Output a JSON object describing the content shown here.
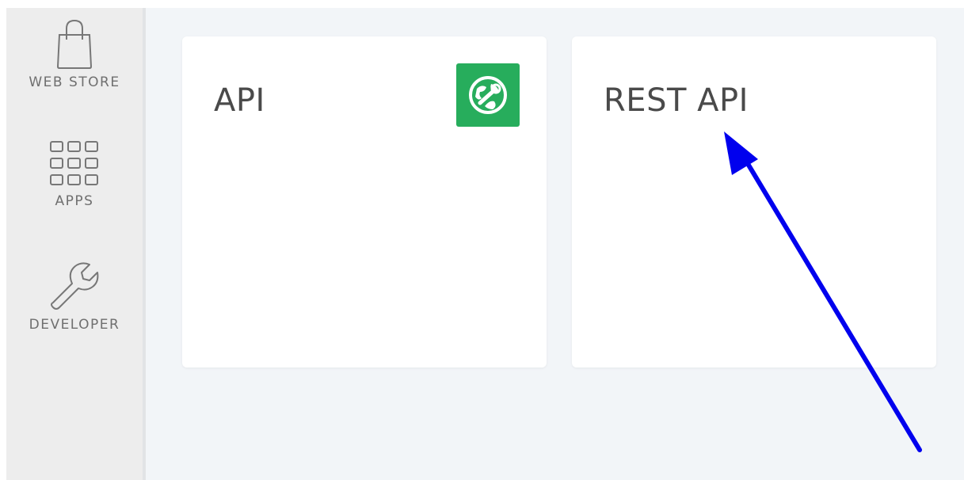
{
  "sidebar": {
    "items": [
      {
        "label": "WEB STORE",
        "icon": "shopping-bag-icon"
      },
      {
        "label": "APPS",
        "icon": "apps-grid-icon"
      },
      {
        "label": "DEVELOPER",
        "icon": "wrench-icon"
      }
    ]
  },
  "cards": [
    {
      "title": "API",
      "icon": "globe-wrench-icon",
      "icon_color": "#27ad5c"
    },
    {
      "title": "REST API"
    }
  ],
  "colors": {
    "sidebar_bg": "#ededed",
    "main_bg": "#f2f5f8",
    "card_bg": "#ffffff",
    "badge_green": "#27ad5c",
    "annotation_arrow": "#0000ee"
  },
  "annotation": {
    "type": "arrow",
    "points_to": "REST API"
  }
}
